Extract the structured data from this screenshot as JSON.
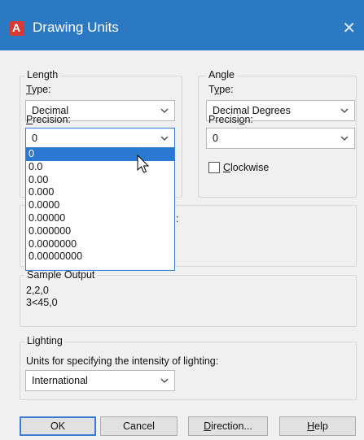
{
  "window": {
    "title": "Drawing Units",
    "close_glyph": "✕",
    "app_icon": "autocad-icon"
  },
  "length": {
    "group_label": "Length",
    "type_label": "Type:",
    "type_value": "Decimal",
    "precision_label": "Precision:",
    "precision_value": "0",
    "precision_options": [
      "0",
      "0.0",
      "0.00",
      "0.000",
      "0.0000",
      "0.00000",
      "0.000000",
      "0.0000000",
      "0.00000000"
    ],
    "highlighted_option_index": 0
  },
  "angle": {
    "group_label": "Angle",
    "type_label": "Type:",
    "type_value": "Decimal Degrees",
    "precision_label": "Precision:",
    "precision_value": "0",
    "clockwise_label": "Clockwise",
    "clockwise_checked": false
  },
  "insertion_scale": {
    "partial_label": ":"
  },
  "sample_output": {
    "label": "Sample Output",
    "lines": [
      "2,2,0",
      "3<45,0"
    ]
  },
  "lighting": {
    "group_label": "Lighting",
    "units_label": "Units for specifying the intensity of lighting:",
    "units_value": "International"
  },
  "buttons": {
    "ok": "OK",
    "cancel": "Cancel",
    "direction": "Direction...",
    "help": "Help"
  },
  "colors": {
    "title_bar": "#2b79c2",
    "selection": "#2a78d0",
    "focus_border": "#3b7bd1"
  }
}
